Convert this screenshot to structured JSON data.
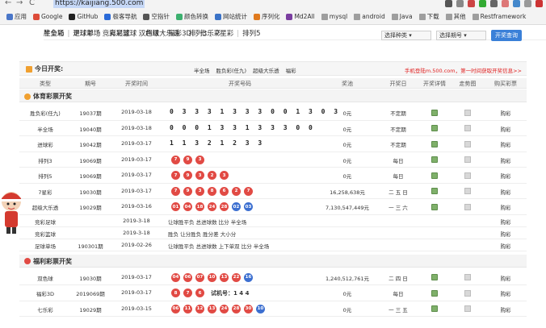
{
  "browser": {
    "url": "https://kaijiang.500.com",
    "back": "←",
    "forward": "→",
    "reload": "C"
  },
  "bookmarks": [
    {
      "label": "应用",
      "color": "#4a76c8",
      "folder": false
    },
    {
      "label": "Google",
      "color": "#dd4b39",
      "folder": false
    },
    {
      "label": "GitHub",
      "color": "#222222",
      "folder": false
    },
    {
      "label": "极客导航",
      "color": "#2a6ad8",
      "folder": false
    },
    {
      "label": "空指针",
      "color": "#555555",
      "folder": false
    },
    {
      "label": "颜色转换",
      "color": "#3cb06f",
      "folder": false
    },
    {
      "label": "网站统计",
      "color": "#3b73c7",
      "folder": false
    },
    {
      "label": "序列化",
      "color": "#e07a1e",
      "folder": false
    },
    {
      "label": "Md2All",
      "color": "#7a3ea0",
      "folder": false
    },
    {
      "label": "mysql",
      "color": "#9e9e9e",
      "folder": true
    },
    {
      "label": "android",
      "color": "#9e9e9e",
      "folder": true
    },
    {
      "label": "Java",
      "color": "#9e9e9e",
      "folder": true
    },
    {
      "label": "下载",
      "color": "#9e9e9e",
      "folder": true
    },
    {
      "label": "其他",
      "color": "#9e9e9e",
      "folder": true
    },
    {
      "label": "Restframework",
      "color": "#9e9e9e",
      "folder": true
    }
  ],
  "lotnav": {
    "row1": [
      "胜负彩",
      "进球彩",
      "竞彩足球",
      "双色球",
      "福彩3D",
      "七乐彩"
    ],
    "row2": [
      "半全场",
      "足球单场",
      "竞彩篮球",
      "超级大乐透",
      "排列3",
      "7星彩",
      "排列5"
    ]
  },
  "selects": {
    "kind": "选择种类",
    "issue": "选择期号",
    "button": "开奖查询"
  },
  "today": {
    "title": "今日开奖:",
    "items": [
      "半全场",
      "胜负彩(任九)",
      "超级大乐透",
      "福彩"
    ],
    "promo": "手机登陆m.500.com，第一时间获取开奖信息>>"
  },
  "headers": [
    "类型",
    "期号",
    "开奖时间",
    "开奖号码",
    "奖池",
    "开奖日",
    "开奖详情",
    "走势图",
    "购买彩票"
  ],
  "sections": {
    "sports": "体育彩票开奖",
    "welfare": "福利彩票开奖"
  },
  "sports_rows": [
    {
      "type": "胜负彩(任九)",
      "issue": "19037期",
      "date": "2019-03-18",
      "digits": "0 3 3 3 1 3 3 3 0 0 1 3 0 3",
      "pool": "0元",
      "day": "不定期",
      "buy": "购彩"
    },
    {
      "type": "半全场",
      "issue": "19040期",
      "date": "2019-03-18",
      "digits": "0 0 0 1 3 3 1 3 3 3 0 0",
      "pool": "0元",
      "day": "不定期",
      "buy": "购彩"
    },
    {
      "type": "进球彩",
      "issue": "19042期",
      "date": "2019-03-17",
      "digits": "1 1 3 2 1 2 3 3",
      "pool": "0元",
      "day": "不定期",
      "buy": "购彩"
    },
    {
      "type": "排列3",
      "issue": "19069期",
      "date": "2019-03-17",
      "balls": [
        "7",
        "9",
        "3"
      ],
      "pool": "0元",
      "day": "每日",
      "buy": "购彩"
    },
    {
      "type": "排列5",
      "issue": "19069期",
      "date": "2019-03-17",
      "balls": [
        "7",
        "9",
        "3",
        "2",
        "3"
      ],
      "pool": "0元",
      "day": "每日",
      "buy": "购彩"
    },
    {
      "type": "7星彩",
      "issue": "19030期",
      "date": "2019-03-17",
      "balls": [
        "7",
        "9",
        "3",
        "8",
        "6",
        "2",
        "7"
      ],
      "pool": "16,258,638元",
      "day": "二 五 日",
      "buy": "购彩"
    },
    {
      "type": "超级大乐透",
      "issue": "19029期",
      "date": "2019-03-16",
      "balls": [
        "01",
        "04",
        "18",
        "24",
        "28",
        "02",
        "03"
      ],
      "blue": [
        5,
        6
      ],
      "pool": "7,130,547,449元",
      "day": "一 三 六",
      "buy": "购彩"
    },
    {
      "type": "竞彩足球",
      "issue": "",
      "date": "2019-3-18",
      "text": "让球胜平负 总进球数 比分 半全场",
      "buy": "购彩"
    },
    {
      "type": "竞彩篮球",
      "issue": "",
      "date": "2019-3-18",
      "text": "胜负 让分胜负 胜分差 大小分",
      "buy": "购彩"
    },
    {
      "type": "足球单场",
      "issue": "190301期",
      "date": "2019-02-26",
      "text": "让球胜平负 总进球数 上下单双 比分 半全场",
      "buy": "购彩"
    }
  ],
  "welfare_rows": [
    {
      "type": "双色球",
      "issue": "19030期",
      "date": "2019-03-17",
      "balls": [
        "04",
        "06",
        "07",
        "10",
        "13",
        "22",
        "16"
      ],
      "blue": [
        6
      ],
      "pool": "1,240,512,761元",
      "day": "二 四 日",
      "buy": "购彩"
    },
    {
      "type": "福彩3D",
      "issue": "2019069期",
      "date": "2019-03-17",
      "balls": [
        "8",
        "7",
        "6"
      ],
      "extra": "试机号：1 4 4",
      "pool": "0元",
      "day": "每日",
      "buy": "购彩"
    },
    {
      "type": "七乐彩",
      "issue": "19029期",
      "date": "2019-03-15",
      "balls": [
        "06",
        "11",
        "12",
        "13",
        "24",
        "28",
        "30",
        "10"
      ],
      "blue": [
        7
      ],
      "pool": "0元",
      "day": "一 三 五",
      "buy": "购彩"
    }
  ],
  "colors": {
    "accent": "#3a80d8",
    "ball": "#e14a44",
    "blue_ball": "#3c6fd0",
    "promo": "#e02020"
  }
}
